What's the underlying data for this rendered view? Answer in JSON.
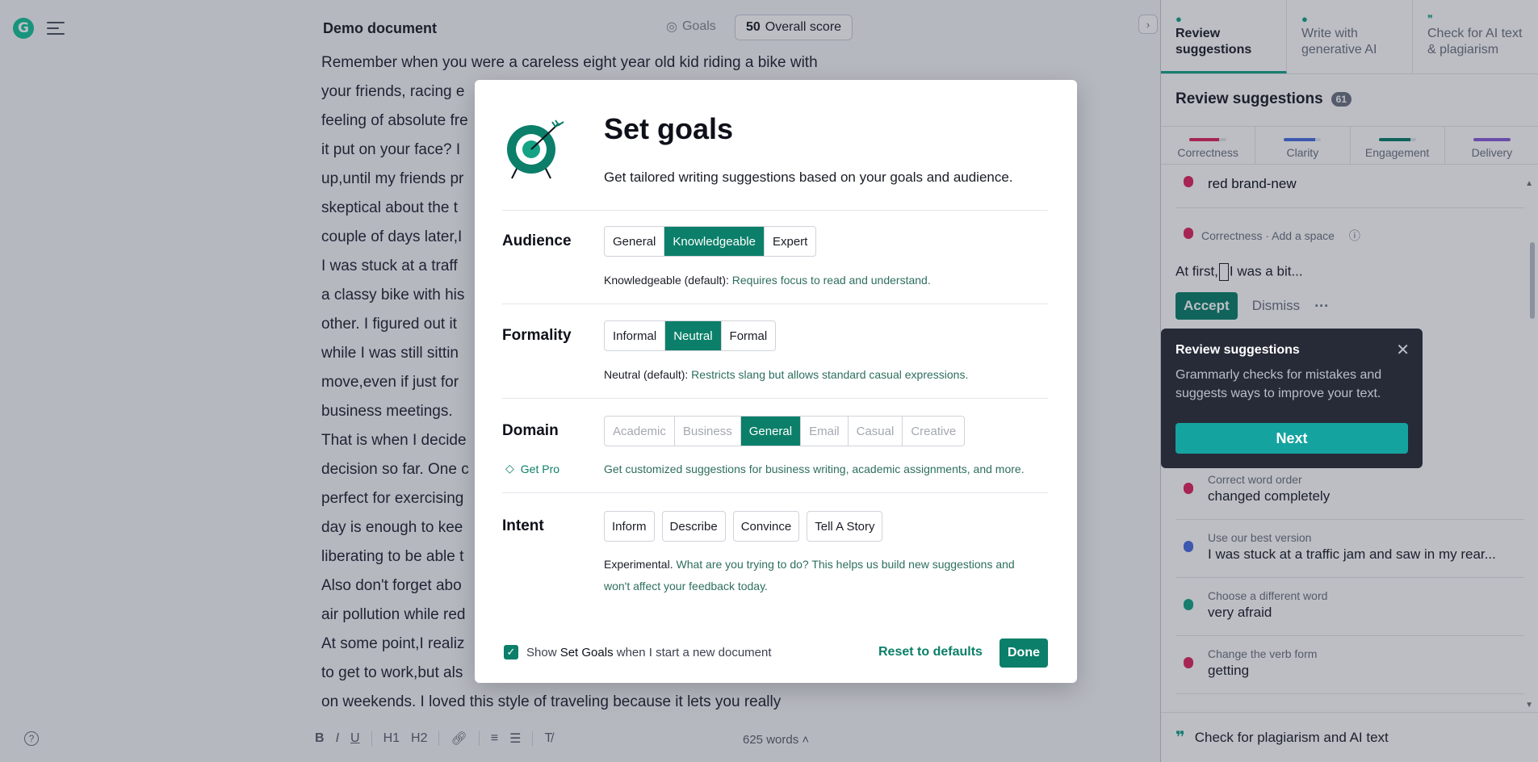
{
  "document": {
    "title": "Demo document",
    "goals_label": "Goals",
    "score_value": "50",
    "score_label": "Overall score",
    "word_count": "625 words",
    "lines": [
      "Remember when you were a careless eight year old kid riding a bike with",
      "your friends, racing e",
      "feeling of absolute fre",
      "it put on your face? I",
      "up,until my friends pr",
      "skeptical about the t",
      "couple of days later,I",
      "I was stuck at a traff",
      "a classy bike with his",
      "other. I figured out it",
      "while I was still sittin",
      "move,even if just for",
      "business meetings.",
      "That is when I decide",
      "decision so far. One c",
      "perfect for exercising",
      "day is enough to kee",
      "liberating to be able t",
      "Also don't forget abo",
      "air pollution while red",
      "At some point,I realiz",
      "to get to work,but als",
      "on weekends. I loved this style of traveling because it lets you really"
    ]
  },
  "format_bar": [
    "B",
    "I",
    "U",
    "H1",
    "H2",
    "link",
    "ol",
    "ul",
    "clear"
  ],
  "panel": {
    "tabs": [
      {
        "label": "Review suggestions",
        "icon": "grammarly-icon"
      },
      {
        "label": "Write with generative AI",
        "icon": "bulb-icon"
      },
      {
        "label": "Check for AI text & plagiarism",
        "icon": "quote-icon"
      }
    ],
    "heading": "Review suggestions",
    "count": "61",
    "categories": [
      {
        "label": "Correctness",
        "color": "#e0245e",
        "fill": 0.8
      },
      {
        "label": "Clarity",
        "color": "#4a6ee0",
        "fill": 0.85
      },
      {
        "label": "Engagement",
        "color": "#0b7f69",
        "fill": 0.85
      },
      {
        "label": "Delivery",
        "color": "#8a5bd6",
        "fill": 1.0
      }
    ],
    "first_item_text": "red brand-new",
    "expanded": {
      "meta": "Correctness · Add a space",
      "text_before": "At first,",
      "text_after": "I was a bit...",
      "accept": "Accept",
      "dismiss": "Dismiss"
    },
    "items": [
      {
        "title": "Correct word order",
        "text": "changed completely",
        "color": "#e0245e"
      },
      {
        "title": "Use our best version",
        "text": "I was stuck at a traffic jam and saw in my rear...",
        "color": "#4a6ee0"
      },
      {
        "title": "Choose a different word",
        "text": "very afraid",
        "color": "#15a386"
      },
      {
        "title": "Change the verb form",
        "text": "getting",
        "color": "#e0245e"
      }
    ],
    "footer": "Check for plagiarism and AI text"
  },
  "tooltip": {
    "title": "Review suggestions",
    "body": "Grammarly checks for mistakes and suggests ways to improve your text.",
    "next": "Next"
  },
  "modal": {
    "title": "Set goals",
    "subtitle": "Get tailored writing suggestions based on your goals and audience.",
    "audience": {
      "label": "Audience",
      "options": [
        "General",
        "Knowledgeable",
        "Expert"
      ],
      "selected": "Knowledgeable",
      "desc_key": "Knowledgeable (default):",
      "desc": "Requires focus to read and understand."
    },
    "formality": {
      "label": "Formality",
      "options": [
        "Informal",
        "Neutral",
        "Formal"
      ],
      "selected": "Neutral",
      "desc_key": "Neutral (default):",
      "desc": "Restricts slang but allows standard casual expressions."
    },
    "domain": {
      "label": "Domain",
      "options": [
        "Academic",
        "Business",
        "General",
        "Email",
        "Casual",
        "Creative"
      ],
      "selected": "General",
      "get_pro": "Get Pro",
      "desc": "Get customized suggestions for business writing, academic assignments, and more."
    },
    "intent": {
      "label": "Intent",
      "options": [
        "Inform",
        "Describe",
        "Convince",
        "Tell A Story"
      ],
      "desc_key": "Experimental.",
      "desc": "What are you trying to do? This helps us build new suggestions and won't affect your feedback today."
    },
    "show_check": "Show",
    "show_check_bold": "Set Goals",
    "show_check_tail": "when I start a new document",
    "reset": "Reset to defaults",
    "done": "Done"
  }
}
